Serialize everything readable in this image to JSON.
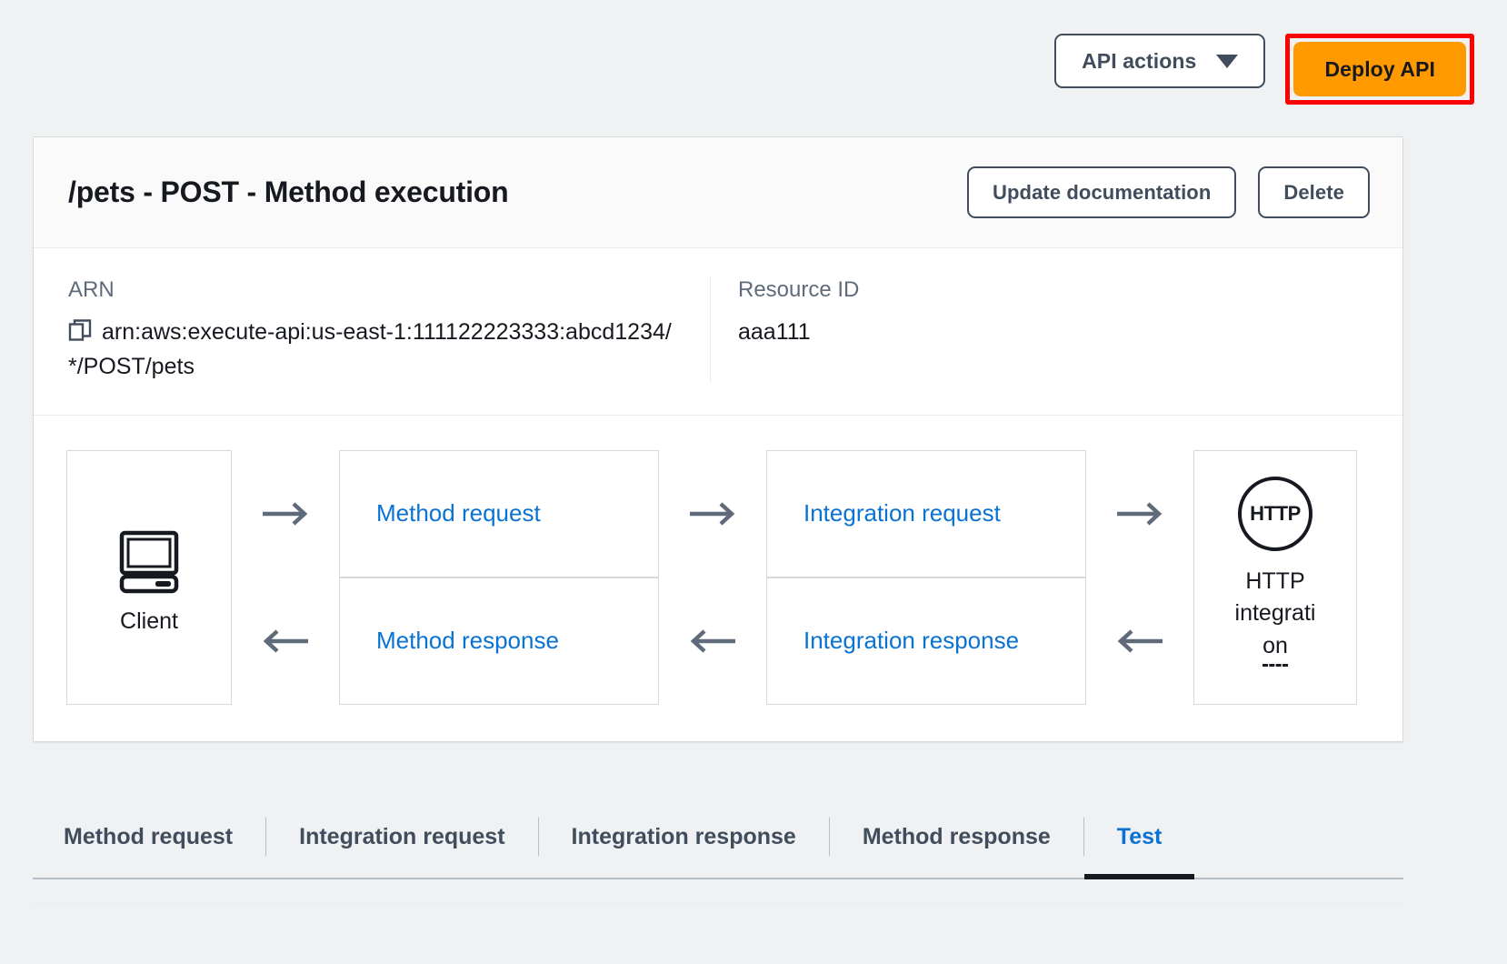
{
  "top_bar": {
    "api_actions_label": "API actions",
    "api_actions_icon": "chevron-down-icon",
    "deploy_label": "Deploy API",
    "deploy_bg_color": "#ff9900",
    "highlight_color": "#ff0000"
  },
  "card": {
    "title": "/pets - POST - Method execution",
    "update_doc_label": "Update documentation",
    "delete_label": "Delete"
  },
  "info": {
    "arn_label": "ARN",
    "arn_value": "arn:aws:execute-api:us-east-1:111122223333:abcd1234/*/POST/pets",
    "copy_icon": "copy-icon",
    "resource_id_label": "Resource ID",
    "resource_id_value": "aaa111"
  },
  "flow": {
    "client_label": "Client",
    "client_icon": "desktop-computer-icon",
    "method_request": "Method request",
    "integration_request": "Integration request",
    "integration_response": "Integration response",
    "method_response": "Method response",
    "arrow_right_icon": "arrow-right-icon",
    "arrow_left_icon": "arrow-left-icon",
    "http_badge": "HTTP",
    "http_label_line1": "HTTP",
    "http_label_line2": "integrati",
    "http_label_line3": "on",
    "link_color": "#0972d3",
    "arrow_color": "#5f6b7a"
  },
  "tabs": [
    {
      "label": "Method request",
      "active": false
    },
    {
      "label": "Integration request",
      "active": false
    },
    {
      "label": "Integration response",
      "active": false
    },
    {
      "label": "Method response",
      "active": false
    },
    {
      "label": "Test",
      "active": true
    }
  ]
}
